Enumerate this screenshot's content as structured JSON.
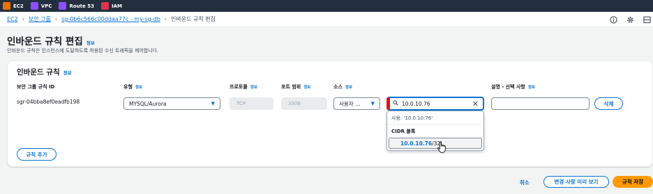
{
  "topbar": {
    "services": [
      {
        "label": "EC2",
        "color": "#ed7100"
      },
      {
        "label": "VPC",
        "color": "#8c4fff"
      },
      {
        "label": "Route 53",
        "color": "#8c4fff"
      },
      {
        "label": "IAM",
        "color": "#dd344c"
      }
    ]
  },
  "breadcrumb": {
    "items": [
      "EC2",
      "보안 그룹",
      "sg-0b6c566c00ddaa77c - my-sg-db"
    ],
    "current": "인바운드 규칙 편집"
  },
  "page": {
    "title": "인바운드 규칙 편집",
    "info": "정보",
    "description": "인바운드 규칙은 인스턴스에 도달하도록 허용된 수신 트래픽을 제어합니다."
  },
  "panel": {
    "title": "인바운드 규칙",
    "info": "정보",
    "columns": {
      "rule_id": "보안 그룹 규칙 ID",
      "type": "유형",
      "protocol": "프로토콜",
      "port": "포트 범위",
      "source": "소스",
      "description": "설명 - 선택 사항",
      "info": "정보"
    },
    "row": {
      "rule_id": "sgr-04bba8ef0eadfb198",
      "type": "MYSQL/Aurora",
      "protocol": "TCP",
      "port": "3306",
      "source_type": "사용자 ...",
      "source_value": "10.0.10.76",
      "description": "",
      "delete_label": "삭제"
    },
    "add_rule_label": "규칙 추가"
  },
  "dropdown": {
    "use_label": "사용: '10.0.10.76'",
    "group_label": "CIDR 블록",
    "option_highlight": "10.0.10.76",
    "option_rest": "/32"
  },
  "footer": {
    "cancel": "취소",
    "preview": "변경 사항 미리 보기",
    "save": "규칙 저장"
  }
}
